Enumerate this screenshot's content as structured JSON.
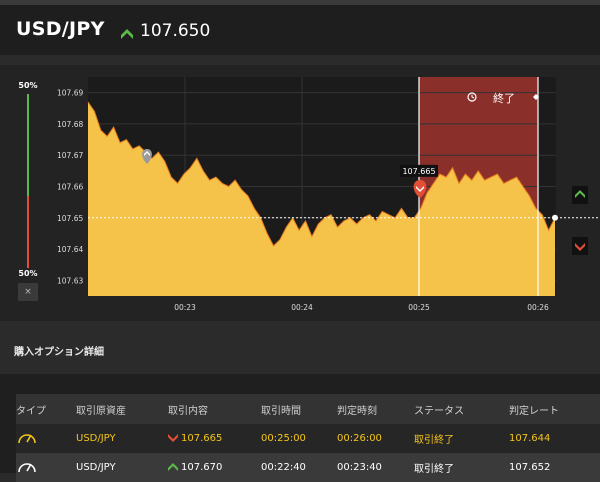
{
  "header": {
    "pair": "USD/JPY",
    "rate": "107.650",
    "rate_direction_icon": "up-arrow-icon",
    "up_color": "#5cb94a",
    "down_color": "#e24f37"
  },
  "side_panel": {
    "top_pct": "50%",
    "bottom_pct": "50%",
    "close": "×"
  },
  "chart": {
    "end_label": "終了",
    "end_icon": "history-icon",
    "price_badge": "107.665",
    "line_color": "#f5c518"
  },
  "chart_data": {
    "type": "area",
    "y_ticks": [
      "107.69",
      "107.68",
      "107.67",
      "107.66",
      "107.65",
      "107.64",
      "107.63"
    ],
    "x_ticks": [
      "00:23",
      "00:24",
      "00:25",
      "00:26"
    ],
    "ylim": [
      107.625,
      107.695
    ],
    "current_rate": 107.65,
    "entry_rate": 107.665,
    "series": [
      {
        "values": [
          107.687,
          107.684,
          107.678,
          107.676,
          107.679,
          107.674,
          107.675,
          107.672,
          107.673,
          107.671,
          107.669,
          107.671,
          107.668,
          107.663,
          107.661,
          107.664,
          107.666,
          107.669,
          107.665,
          107.662,
          107.663,
          107.661,
          107.66,
          107.662,
          107.659,
          107.657,
          107.653,
          107.65,
          107.645,
          107.641,
          107.643,
          107.647,
          107.65,
          107.646,
          107.649,
          107.644,
          107.648,
          107.65,
          107.651,
          107.647,
          107.649,
          107.65,
          107.648,
          107.65,
          107.651,
          107.649,
          107.652,
          107.651,
          107.65,
          107.653,
          107.65,
          107.65,
          107.653,
          107.658,
          107.661,
          107.664,
          107.663,
          107.666,
          107.661,
          107.664,
          107.662,
          107.665,
          107.662,
          107.663,
          107.664,
          107.661,
          107.662,
          107.663,
          107.66,
          107.657,
          107.653,
          107.651,
          107.646,
          107.65
        ]
      }
    ]
  },
  "details": {
    "title": "購入オプション詳細",
    "columns": [
      "タイプ",
      "取引原資産",
      "取引内容",
      "取引時間",
      "判定時刻",
      "ステータス",
      "判定レート"
    ],
    "rows": [
      {
        "type_icon": "gauge-icon",
        "asset": "USD/JPY",
        "direction_icon": "down-arrow-icon",
        "entry": "107.665",
        "trade_time": "00:25:00",
        "judge_time": "00:26:00",
        "status": "取引終了",
        "judge_rate": "107.644"
      },
      {
        "type_icon": "gauge-icon",
        "asset": "USD/JPY",
        "direction_icon": "up-arrow-icon",
        "entry": "107.670",
        "trade_time": "00:22:40",
        "judge_time": "00:23:40",
        "status": "取引終了",
        "judge_rate": "107.652"
      }
    ]
  }
}
